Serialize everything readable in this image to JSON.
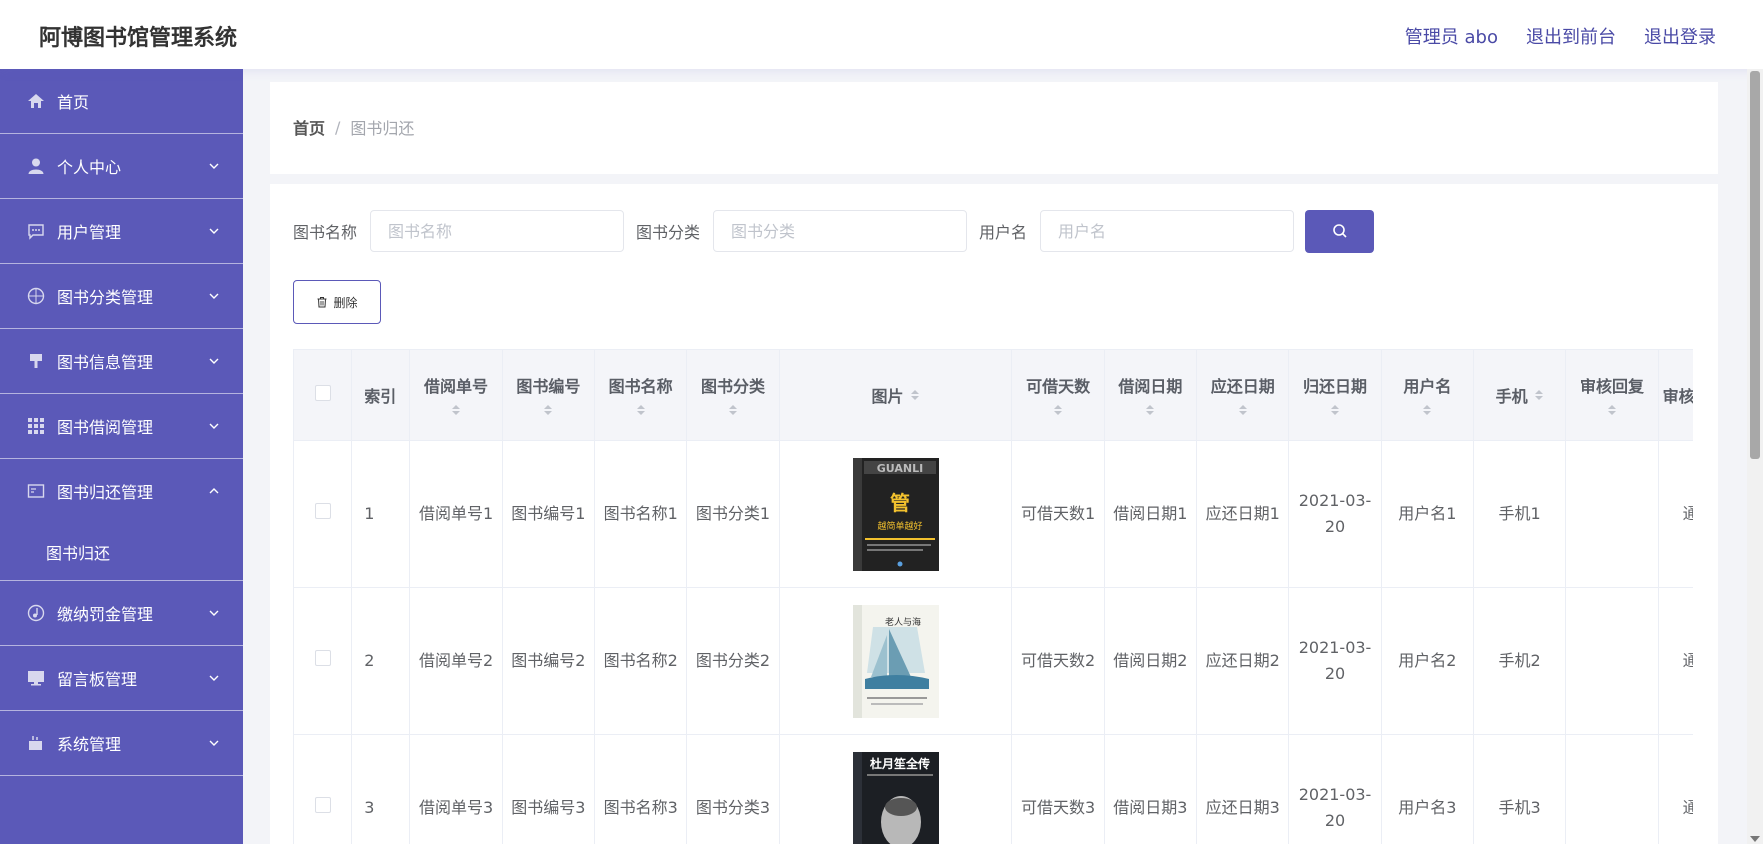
{
  "header": {
    "app_title": "阿博图书馆管理系统",
    "links": [
      "管理员 abo",
      "退出到前台",
      "退出登录"
    ]
  },
  "sidebar": {
    "items": [
      {
        "label": "首页",
        "icon": "home-icon",
        "has_children": false
      },
      {
        "label": "个人中心",
        "icon": "user-icon",
        "has_children": true
      },
      {
        "label": "用户管理",
        "icon": "chat-icon",
        "has_children": true
      },
      {
        "label": "图书分类管理",
        "icon": "compass-icon",
        "has_children": true
      },
      {
        "label": "图书信息管理",
        "icon": "brush-icon",
        "has_children": true
      },
      {
        "label": "图书借阅管理",
        "icon": "grid-icon",
        "has_children": true
      },
      {
        "label": "图书归还管理",
        "icon": "card-icon",
        "has_children": true,
        "expanded": true,
        "children": [
          "图书归还"
        ]
      },
      {
        "label": "缴纳罚金管理",
        "icon": "music-icon",
        "has_children": true
      },
      {
        "label": "留言板管理",
        "icon": "monitor-icon",
        "has_children": true
      },
      {
        "label": "系统管理",
        "icon": "cup-icon",
        "has_children": true
      }
    ]
  },
  "breadcrumb": {
    "home": "首页",
    "separator": "/",
    "current": "图书归还"
  },
  "search": {
    "fields": [
      {
        "label": "图书名称",
        "placeholder": "图书名称"
      },
      {
        "label": "图书分类",
        "placeholder": "图书分类"
      },
      {
        "label": "用户名",
        "placeholder": "用户名"
      }
    ]
  },
  "toolbar": {
    "delete_label": "删除"
  },
  "table": {
    "headers": [
      "索引",
      "借阅单号",
      "图书编号",
      "图书名称",
      "图书分类",
      "图片",
      "可借天数",
      "借阅日期",
      "应还日期",
      "归还日期",
      "用户名",
      "手机",
      "审核回复",
      "审核"
    ],
    "rows": [
      {
        "index": "1",
        "cells": [
          "借阅单号1",
          "图书编号1",
          "图书名称1",
          "图书分类1"
        ],
        "cover": "管理越简单越好",
        "cells2": [
          "可借天数1",
          "借阅日期1",
          "应还日期1",
          "2021-03-20",
          "用户名1",
          "手机1",
          "",
          "通"
        ]
      },
      {
        "index": "2",
        "cells": [
          "借阅单号2",
          "图书编号2",
          "图书名称2",
          "图书分类2"
        ],
        "cover": "老人与海",
        "cells2": [
          "可借天数2",
          "借阅日期2",
          "应还日期2",
          "2021-03-20",
          "用户名2",
          "手机2",
          "",
          "通"
        ]
      },
      {
        "index": "3",
        "cells": [
          "借阅单号3",
          "图书编号3",
          "图书名称3",
          "图书分类3"
        ],
        "cover": "杜月笙全传",
        "cells2": [
          "可借天数3",
          "借阅日期3",
          "应还日期3",
          "2021-03-20",
          "用户名3",
          "手机3",
          "",
          "通"
        ]
      }
    ]
  },
  "colors": {
    "primary": "#5b59b8",
    "header_link": "#4a4aa6"
  }
}
